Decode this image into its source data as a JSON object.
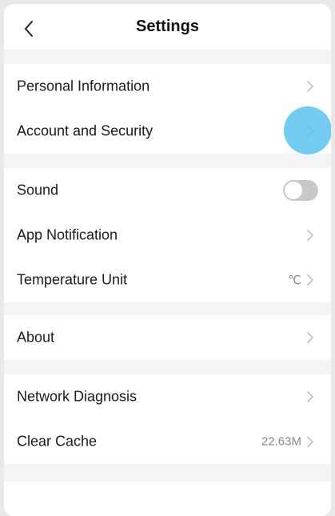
{
  "header": {
    "title": "Settings",
    "back_icon": "chevron-left-icon"
  },
  "sections": [
    {
      "items": [
        {
          "label": "Personal Information",
          "type": "link"
        },
        {
          "label": "Account and Security",
          "type": "link"
        }
      ]
    },
    {
      "items": [
        {
          "label": "Sound",
          "type": "toggle",
          "enabled": false
        },
        {
          "label": "App Notification",
          "type": "link"
        },
        {
          "label": "Temperature Unit",
          "type": "link",
          "value": "℃"
        }
      ]
    },
    {
      "items": [
        {
          "label": "About",
          "type": "link"
        }
      ]
    },
    {
      "items": [
        {
          "label": "Network Diagnosis",
          "type": "link"
        },
        {
          "label": "Clear Cache",
          "type": "link",
          "value": "22.63M"
        }
      ]
    }
  ],
  "colors": {
    "background": "#ffffff",
    "section_gap": "#f4f4f5",
    "chevron": "#c0c0c4",
    "touch_indicator": "#5bc3f0",
    "toggle_off": "#c8c8ca"
  }
}
